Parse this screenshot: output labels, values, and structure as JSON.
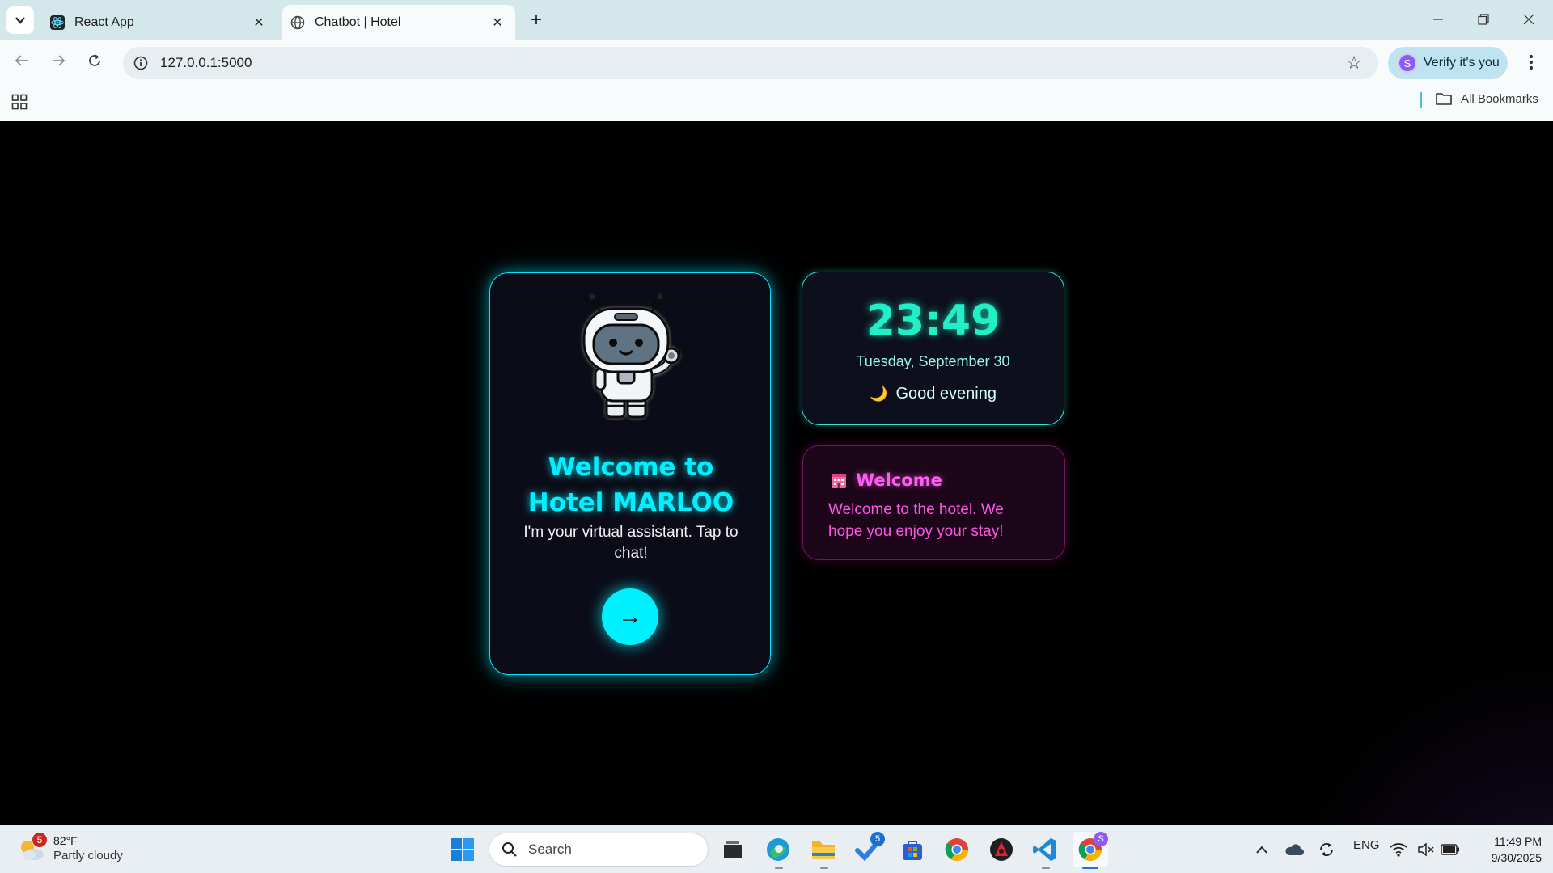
{
  "browser": {
    "tabs": [
      {
        "title": "React App",
        "active": false
      },
      {
        "title": "Chatbot | Hotel",
        "active": true
      }
    ],
    "url": "127.0.0.1:5000",
    "verify_label": "Verify it's you",
    "profile_initial": "S",
    "bookmarks_label": "All Bookmarks"
  },
  "page": {
    "welcome": {
      "title": "Welcome to Hotel MARLOO",
      "subtitle": "I'm your virtual assistant. Tap to chat!",
      "button_symbol": "→"
    },
    "clock": {
      "time": "23:49",
      "date": "Tuesday, September 30",
      "greeting": "Good evening",
      "greeting_icon": "🌙"
    },
    "notice": {
      "title": "Welcome",
      "body": "Welcome to the hotel. We hope you enjoy your stay!"
    }
  },
  "taskbar": {
    "weather": {
      "temp": "82°F",
      "desc": "Partly cloudy",
      "badge": "5"
    },
    "search_placeholder": "Search",
    "todo_badge": "5",
    "chrome_badge": "S",
    "language": "ENG",
    "time": "11:49 PM",
    "date": "9/30/2025"
  },
  "colors": {
    "cyan_accent": "#00f0ff",
    "clock_green": "#20f0c8",
    "magenta_accent": "#ff5bf0"
  }
}
